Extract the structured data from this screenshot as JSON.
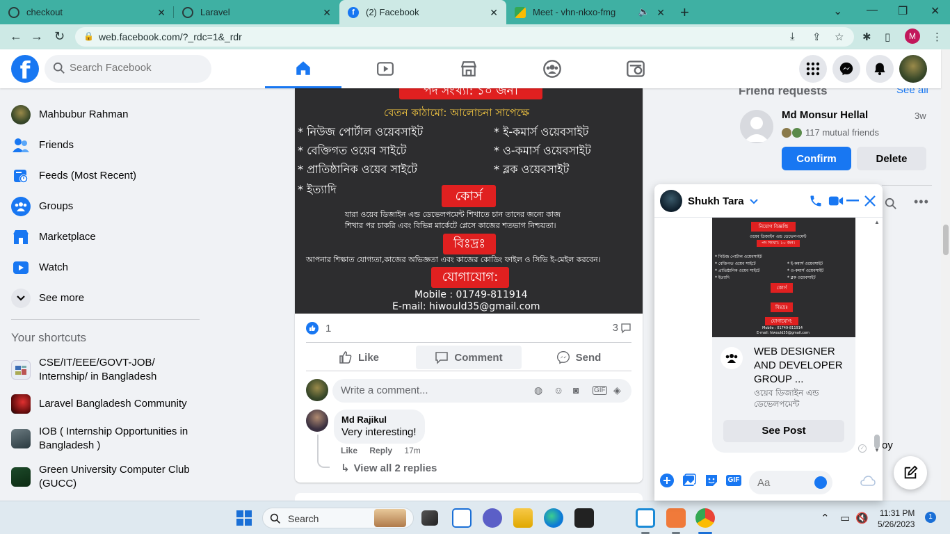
{
  "browser": {
    "tabs": [
      {
        "title": "checkout"
      },
      {
        "title": "Laravel"
      },
      {
        "title": "(2) Facebook"
      },
      {
        "title": "Meet - vhn-nkxo-fmg"
      }
    ],
    "url": "web.facebook.com/?_rdc=1&_rdr",
    "profile_initial": "M"
  },
  "fb": {
    "logo": "f",
    "search_placeholder": "Search Facebook"
  },
  "sidebar": {
    "items": [
      {
        "label": "Mahbubur Rahman",
        "icon": "profile-avatar"
      },
      {
        "label": "Friends",
        "icon": "friends-icon"
      },
      {
        "label": "Feeds (Most Recent)",
        "icon": "feeds-icon"
      },
      {
        "label": "Groups",
        "icon": "groups-icon"
      },
      {
        "label": "Marketplace",
        "icon": "marketplace-icon"
      },
      {
        "label": "Watch",
        "icon": "watch-icon"
      },
      {
        "label": "See more",
        "icon": "chevron-down-icon"
      }
    ],
    "shortcuts_title": "Your shortcuts",
    "shortcuts": [
      {
        "label": "CSE/IT/EEE/GOVT-JOB/ Internship/ in Bangladesh"
      },
      {
        "label": "Laravel Bangladesh Community"
      },
      {
        "label": "IOB ( Internship Opportunities in Bangladesh )"
      },
      {
        "label": "Green University Computer Club (GUCC)"
      }
    ]
  },
  "post": {
    "poster": {
      "vacancy": "পদ সংখ্যা: ১০ জন।",
      "salary": "বেতন কাঠামো: আলোচনা সাপেক্ষে",
      "left_list": [
        "* নিউজ পোর্টাল ওয়েবসাইট",
        "* বেক্তিগত ওয়েব সাইটে",
        "* প্রাতিষ্ঠানিক ওয়েব সাইটে",
        "* ইত্যাদি"
      ],
      "right_list": [
        "* ই-কমার্স ওয়েবসাইট",
        "* ও-কমার্স ওয়েবসাইট",
        "* ব্লক ওয়েবসাইট"
      ],
      "course": "কোর্স",
      "course_text_1": "যারা ওয়েব ডিজাইন এন্ড ডেভেলপমেন্ট শিখাতে চান তাদের জন্যে কাজ",
      "course_text_2": "শিখার পর চাকরি এবং বিভিন্ন মার্কেটে প্লেসে কাজের শতভাগ নিশ্চয়তা।",
      "note": "বিঃদ্রঃ",
      "note_text": "আপনার শিক্ষাত যোগ্যতা,কাজের অভিজ্ঞতা এবং কাজের কোডিং ফাইল ও সিভি ই-মেইল করবেন।",
      "contact": "যোগাযোগ:",
      "mobile": "Mobile : 01749-811914",
      "email": "E-mail: hiwould35@gmail.com"
    },
    "reaction_count": "1",
    "comment_count": "3",
    "actions": {
      "like": "Like",
      "comment": "Comment",
      "send": "Send"
    },
    "comment_placeholder": "Write a comment...",
    "comment": {
      "author": "Md Rajikul",
      "text": "Very interesting!",
      "like": "Like",
      "reply": "Reply",
      "time": "17m",
      "view_replies": "View all 2 replies"
    }
  },
  "right": {
    "friend_requests_title": "Friend requests",
    "see_all": "See all",
    "request": {
      "name": "Md Monsur Hellal",
      "time": "3w",
      "mutual": "117 mutual friends",
      "confirm": "Confirm",
      "delete": "Delete"
    },
    "partial_text": "oy"
  },
  "chat": {
    "name": "Shukh Tara",
    "mini_poster": {
      "title": "নিয়োগ বিজ্ঞপ্তি",
      "subtitle": "ওয়েব ডিজাইন এন্ড ডেভেলপমেন্ট",
      "vacancy": "পদ সংখ্যা: ১০ জন।",
      "course": "কোর্স",
      "note": "বিঃদ্রঃ",
      "contact": "যোগাযোগ:",
      "mobile": "Mobile : 01749-811914",
      "email": "E-mail: hiwould35@gmail.com"
    },
    "group_title": "WEB DESIGNER AND DEVELOPER GROUP ...",
    "group_sub": "ওয়েব ডিজাইন এন্ড ডেভেলপমেন্ট",
    "see_post": "See Post",
    "input_placeholder": "Aa"
  },
  "taskbar": {
    "search": "Search",
    "time": "11:31 PM",
    "date": "5/26/2023",
    "notifications": "1"
  }
}
